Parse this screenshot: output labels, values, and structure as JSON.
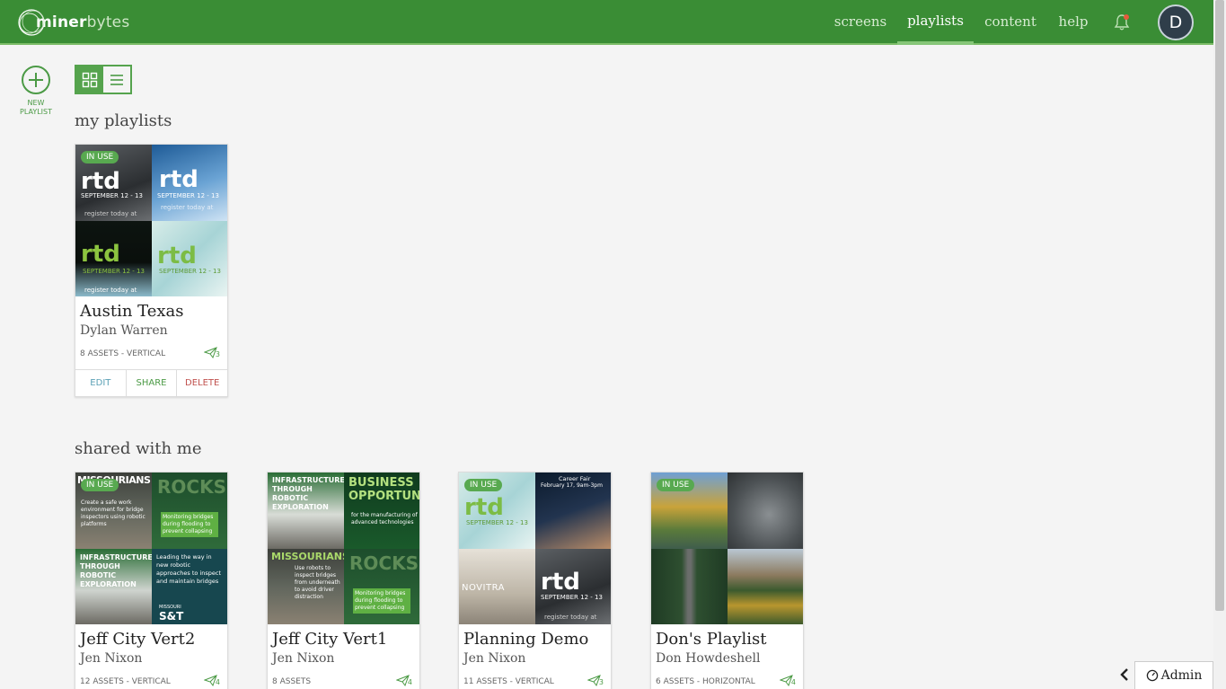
{
  "header": {
    "logo_bold": "miner",
    "logo_light": "bytes",
    "nav": [
      {
        "label": "screens"
      },
      {
        "label": "playlists"
      },
      {
        "label": "content"
      },
      {
        "label": "help"
      }
    ],
    "active_nav": "playlists",
    "avatar_initial": "D"
  },
  "new_playlist": {
    "label_line1": "NEW",
    "label_line2": "PLAYLIST"
  },
  "sections": {
    "my_playlists": "my playlists",
    "shared_with_me": "shared with me"
  },
  "my_playlists": [
    {
      "title": "Austin Texas",
      "owner": "Dylan Warren",
      "meta": "8 ASSETS - VERTICAL",
      "shares": "3",
      "badge": "IN USE",
      "actions": {
        "edit": "EDIT",
        "share": "SHARE",
        "delete": "DELETE"
      },
      "thumb_texts": [
        "rtd",
        "SEPTEMBER 12 - 13",
        "register today at"
      ]
    }
  ],
  "shared_playlists": [
    {
      "title": "Jeff City Vert2",
      "owner": "Jen Nixon",
      "meta": "12 ASSETS - VERTICAL",
      "shares": "4",
      "badge": "IN USE"
    },
    {
      "title": "Jeff City Vert1",
      "owner": "Jen Nixon",
      "meta": "8 ASSETS",
      "shares": "4",
      "badge": ""
    },
    {
      "title": "Planning Demo",
      "owner": "Jen Nixon",
      "meta": "11 ASSETS - VERTICAL",
      "shares": "3",
      "badge": "IN USE"
    },
    {
      "title": "Don's Playlist",
      "owner": "Don Howdeshell",
      "meta": "6 ASSETS - HORIZONTAL",
      "shares": "4",
      "badge": "IN USE"
    }
  ],
  "thumb_text": {
    "infra": "INFRASTRUCTURE THROUGH ROBOTIC EXPLORATION",
    "business": "BUSINESS OPPORTUNITIES",
    "business_sub": "for the manufacturing of advanced technologies",
    "missourians": "MISSOURIANS",
    "rocks": "ROCKS",
    "monitoring": "Monitoring bridges during flooding to prevent collapsing",
    "leading": "Leading the way in new robotic approaches to inspect and maintain bridges",
    "safe_work": "Create a safe work environment for bridge inspectors using robotic platforms",
    "robots": "Use robots to inspect bridges from underneath to avoid driver distraction",
    "career_fair": "Career Fair",
    "career_date": "February 17, 9am-3pm",
    "novitra": "NOVITRA",
    "st_logo": "S&T",
    "missouri": "MISSOURI"
  },
  "admin": {
    "label": "Admin"
  }
}
